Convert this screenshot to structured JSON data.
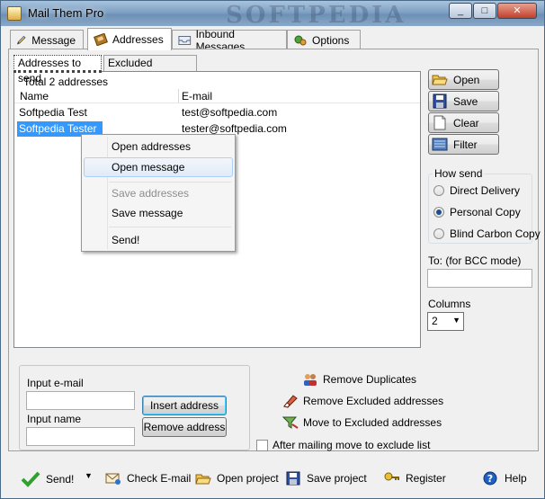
{
  "window": {
    "title": "Mail Them Pro",
    "watermark": "SOFTPEDIA",
    "minimize": "_",
    "maximize": "□",
    "close": "✕"
  },
  "tabs": [
    {
      "label": "Message",
      "icon": "pencil-icon"
    },
    {
      "label": "Addresses",
      "icon": "address-book-icon"
    },
    {
      "label": "Inbound Messages",
      "icon": "inbox-icon"
    },
    {
      "label": "Options",
      "icon": "options-icon"
    }
  ],
  "subtabs": [
    "Addresses to send",
    "Excluded addresses"
  ],
  "list": {
    "total": "Total 2 addresses",
    "columns": [
      "Name",
      "E-mail"
    ],
    "rows": [
      {
        "name": "Softpedia Test",
        "email": "test@softpedia.com",
        "selected": false
      },
      {
        "name": "Softpedia Tester",
        "email": "tester@softpedia.com",
        "selected": true
      }
    ]
  },
  "context_menu": {
    "items": [
      "Open addresses",
      "Open message",
      "Save addresses",
      "Save message",
      "Send!"
    ],
    "hover_index": 1,
    "disabled_index": 2
  },
  "side_buttons": [
    "Open",
    "Save",
    "Clear",
    "Filter"
  ],
  "how_send": {
    "label": "How send",
    "options": [
      "Direct Delivery",
      "Personal Copy",
      "Blind Carbon Copy"
    ],
    "selected": 1
  },
  "to_label": "To: (for BCC mode)",
  "to_value": "",
  "columns_label": "Columns",
  "columns_value": "2",
  "input": {
    "email_label": "Input e-mail",
    "email_value": "",
    "name_label": "Input name",
    "name_value": "",
    "insert": "Insert address",
    "remove": "Remove address"
  },
  "actions": {
    "remove_duplicates": "Remove Duplicates",
    "remove_excluded": "Remove Excluded addresses",
    "move_excluded": "Move to Excluded addresses",
    "after_mailing": "After mailing move to exclude list"
  },
  "bottom": {
    "send": "Send!",
    "send_arrow": "▼",
    "check": "Check E-mail",
    "open": "Open project",
    "save": "Save project",
    "register": "Register",
    "help": "Help"
  }
}
